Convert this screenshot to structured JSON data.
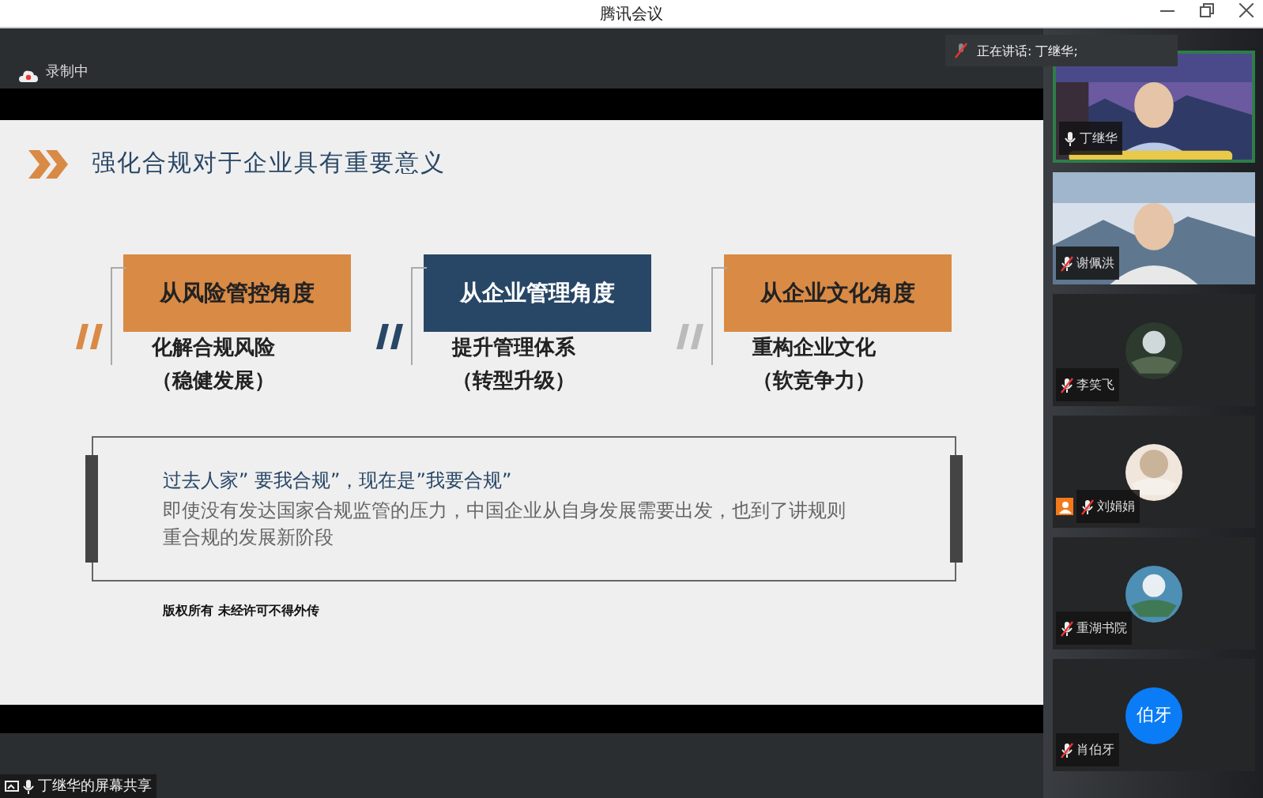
{
  "window": {
    "title": "腾讯会议"
  },
  "recording": {
    "label": "录制中"
  },
  "speaker_bar": {
    "label": "正在讲话: 丁继华;"
  },
  "slide": {
    "title": "强化合规对于企业具有重要意义",
    "columns": [
      {
        "heading": "从风险管控角度",
        "color": "#d98a45",
        "lines": [
          "化解合规风险",
          "（稳健发展）"
        ]
      },
      {
        "heading": "从企业管理角度",
        "color": "#284766",
        "lines": [
          "提升管理体系",
          "（转型升级）"
        ]
      },
      {
        "heading": "从企业文化角度",
        "color": "#d98a45",
        "lines": [
          "重构企业文化",
          "（软竞争力）"
        ]
      }
    ],
    "quote_title": "过去人家” 要我合规”，现在是”我要合规”",
    "quote_body": "即使没有发达国家合规监管的压力，中国企业从自身发展需要出发，也到了讲规则重合规的发展新阶段",
    "footnote": "版权所有  未经许可不得外传"
  },
  "share_label": "丁继华的屏幕共享",
  "participants": [
    {
      "name": "丁继华",
      "kind": "video",
      "muted": false,
      "speaking": true,
      "host": false
    },
    {
      "name": "谢佩洪",
      "kind": "video",
      "muted": true,
      "speaking": false,
      "host": false
    },
    {
      "name": "李笑飞",
      "kind": "avatar",
      "muted": true,
      "speaking": false,
      "host": false
    },
    {
      "name": "刘娟娟",
      "kind": "avatar",
      "muted": true,
      "speaking": false,
      "host": true
    },
    {
      "name": "重湖书院",
      "kind": "avatar",
      "muted": true,
      "speaking": false,
      "host": false
    },
    {
      "name": "肖伯牙",
      "kind": "initials",
      "initials": "伯牙",
      "muted": true,
      "speaking": false,
      "host": false
    }
  ]
}
